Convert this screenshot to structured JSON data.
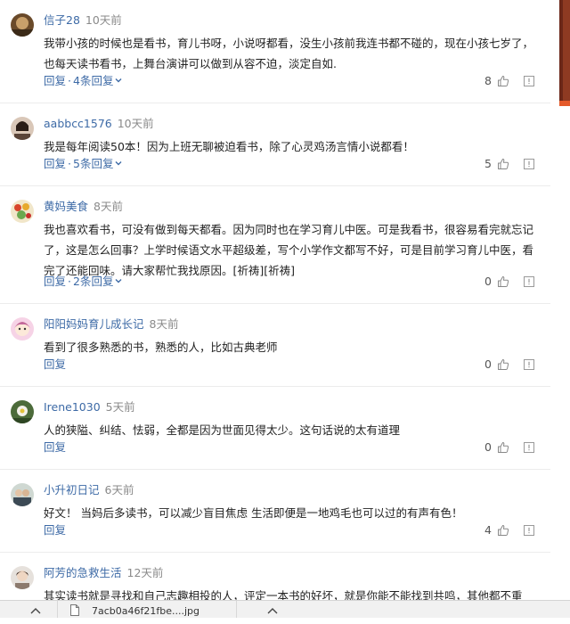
{
  "comments": [
    {
      "user": "信子28",
      "time": "10天前",
      "lines": [
        "我带小孩的时候也是看书，育儿书呀，小说呀都看，没生小孩前我连书都不碰的，现在小孩七岁了，",
        "也每天读书看书，上舞台演讲可以做到从容不迫，淡定自如."
      ],
      "reply": "回复",
      "sep": "·",
      "more": "4条回复",
      "likes": "8",
      "avatar": "photo-brown"
    },
    {
      "user": "aabbcc1576",
      "time": "10天前",
      "lines": [
        "我是每年阅读50本！因为上班无聊被迫看书，除了心灵鸡汤言情小说都看！"
      ],
      "reply": "回复",
      "sep": "·",
      "more": "5条回复",
      "likes": "5",
      "avatar": "photo-portrait"
    },
    {
      "user": "黄妈美食",
      "time": "8天前",
      "lines": [
        "我也喜欢看书，可没有做到每天都看。因为同时也在学习育儿中医。可是我看书，很容易看完就忘记",
        "了，这是怎么回事？上学时候语文水平超级差，写个小学作文都写不好，可是目前学习育儿中医，看",
        "完了还能回味。请大家帮忙我找原因。[祈祷][祈祷]"
      ],
      "reply": "回复",
      "sep": "·",
      "more": "2条回复",
      "likes": "0",
      "avatar": "food"
    },
    {
      "user": "阳阳妈妈育儿成长记",
      "time": "8天前",
      "lines": [
        "看到了很多熟悉的书，熟悉的人，比如古典老师"
      ],
      "reply": "回复",
      "likes": "0",
      "avatar": "cartoon"
    },
    {
      "user": "Irene1030",
      "time": "5天前",
      "lines": [
        "人的狭隘、纠结、怯弱，全都是因为世面见得太少。这句话说的太有道理"
      ],
      "reply": "回复",
      "likes": "0",
      "avatar": "flower"
    },
    {
      "user": "小升初日记",
      "time": "6天前",
      "lines": [
        "好文！ 当妈后多读书，可以减少盲目焦虑 生活即便是一地鸡毛也可以过的有声有色！"
      ],
      "reply": "回复",
      "likes": "4",
      "avatar": "people"
    },
    {
      "user": "阿芳的急救生活",
      "time": "12天前",
      "lines": [
        "其实读书就是寻找和自己志趣相投的人，评定一本书的好坏，就是你能不能找到共鸣，其他都不重"
      ],
      "reply": "",
      "likes": "",
      "avatar": "portrait2"
    }
  ],
  "taskbar": {
    "filename": "7acb0a46f21fbe....jpg"
  },
  "colors": {
    "link": "#3d6aa6",
    "time": "#8a8a8a"
  }
}
